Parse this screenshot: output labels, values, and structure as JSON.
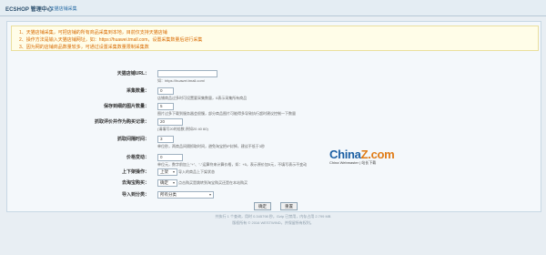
{
  "header": {
    "brand": "ECSHOP 管理中心",
    "breadcrumb": "天猫店铺采集"
  },
  "notice": [
    "1、天猫店铺采集，可把店铺的所有商品采集到本地，目前仅支持天猫店铺",
    "2、操作方法是输入天猫店铺网址，如：https://huawei.tmall.com，设置采集数量后进行采集",
    "3、因为网的店铺商品数量较多，可通过设置采集数量限制采集数"
  ],
  "form": {
    "shop_url": {
      "label": "天猫店铺URL：",
      "value": "",
      "hint": "如：https://huawei.tmall.com/"
    },
    "count": {
      "label": "采集数量：",
      "value": "0",
      "hint": "店铺商品过多时可设置要采集数量，0表示采集所有商品"
    },
    "images": {
      "label": "保存到细的图片数量：",
      "value": "5",
      "hint": "图片过多下载到服务器会很慢，部分商品图片可能得多导致执行超时建议控制一下数量"
    },
    "reviews": {
      "label": "抓取评价并作为购买记录：",
      "value": "20",
      "hint": "(请填写20的倍数,例如20 40 60)"
    },
    "interval": {
      "label": "抓取间隔时间：",
      "value": "3",
      "hint": "单位秒，两商品间隔抓取时间，避免淘宝把IP封掉，建议不低于3秒"
    },
    "price": {
      "label": "价格变动：",
      "value": "0",
      "hint": "单位元，数字前加上\"+\"、\"-\"运算符来计算价格，如：+5，表示原价加5元，不填写表示不变动"
    },
    "shelf": {
      "label": "上下架操作：",
      "value": "上架",
      "hint": "导入的商品上下架状态"
    },
    "source": {
      "label": "去淘宝购买：",
      "value": "确定",
      "hint": "点击购买是跳转到淘宝购买还是在本站购买"
    },
    "category": {
      "label": "导入到分类：",
      "value": "所有分类"
    },
    "submit_label": "确定",
    "reset_label": "重置"
  },
  "watermark": {
    "main_a": "China",
    "main_b": "Z.com",
    "sub": "China Webmaster | 站长下载"
  },
  "footer": [
    "共执行 1 个查询，用时 0.345798 秒，Gzip 已禁用，内存占用 2.799 MB",
    "版权所有 © 2016 WESTWIND，并保留所有权利。"
  ]
}
